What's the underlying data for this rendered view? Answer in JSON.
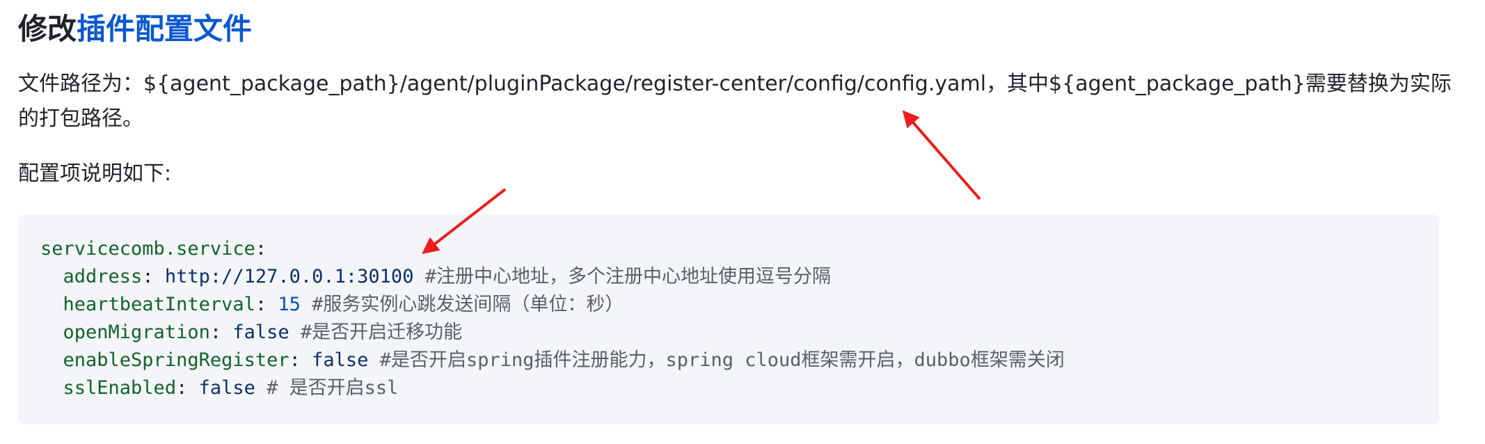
{
  "heading": {
    "prefix": "修改",
    "link": "插件配置文件"
  },
  "paragraph1": "文件路径为：${agent_package_path}/agent/pluginPackage/register-center/config/config.yaml，其中${agent_package_path}需要替换为实际的打包路径。",
  "paragraph2": "配置项说明如下:",
  "code": {
    "root_key": "servicecomb.service",
    "lines": [
      {
        "key": "address",
        "value": "http://127.0.0.1:30100",
        "comment": "#注册中心地址，多个注册中心地址使用逗号分隔"
      },
      {
        "key": "heartbeatInterval",
        "value": "15",
        "comment": "#服务实例心跳发送间隔（单位：秒）"
      },
      {
        "key": "openMigration",
        "value": "false",
        "comment": "#是否开启迁移功能"
      },
      {
        "key": "enableSpringRegister",
        "value": "false",
        "comment": "#是否开启spring插件注册能力，spring cloud框架需开启，dubbo框架需关闭"
      },
      {
        "key": "sslEnabled",
        "value": "false",
        "comment": "# 是否开启ssl"
      }
    ]
  },
  "colors": {
    "link": "#0b57d0",
    "arrow": "#ee1c1c",
    "code_background": "#f3f5f8"
  }
}
